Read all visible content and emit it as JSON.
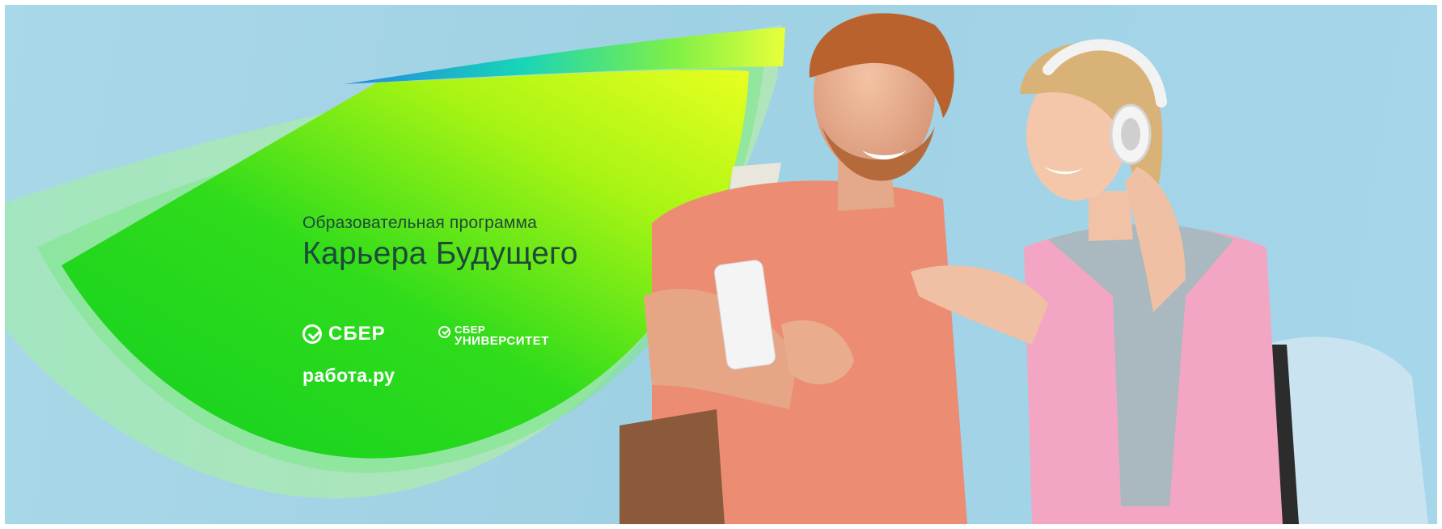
{
  "banner": {
    "subtitle": "Образовательная программа",
    "title": "Карьера Будущего"
  },
  "logos": {
    "sber": "СБЕР",
    "sber_university_line1": "СБЕР",
    "sber_university_line2": "УНИВЕРСИТЕТ",
    "rabota": "работа.ру"
  },
  "colors": {
    "background": "#a6d6ea",
    "green": "#19d12a",
    "lime": "#d9ff1a",
    "title_text": "#1d4a39"
  },
  "photo": {
    "subject": "two students looking at a smartphone",
    "icons": [
      "sber-logo-icon",
      "sber-university-logo-icon",
      "smartphone",
      "headphones",
      "backpack"
    ]
  }
}
